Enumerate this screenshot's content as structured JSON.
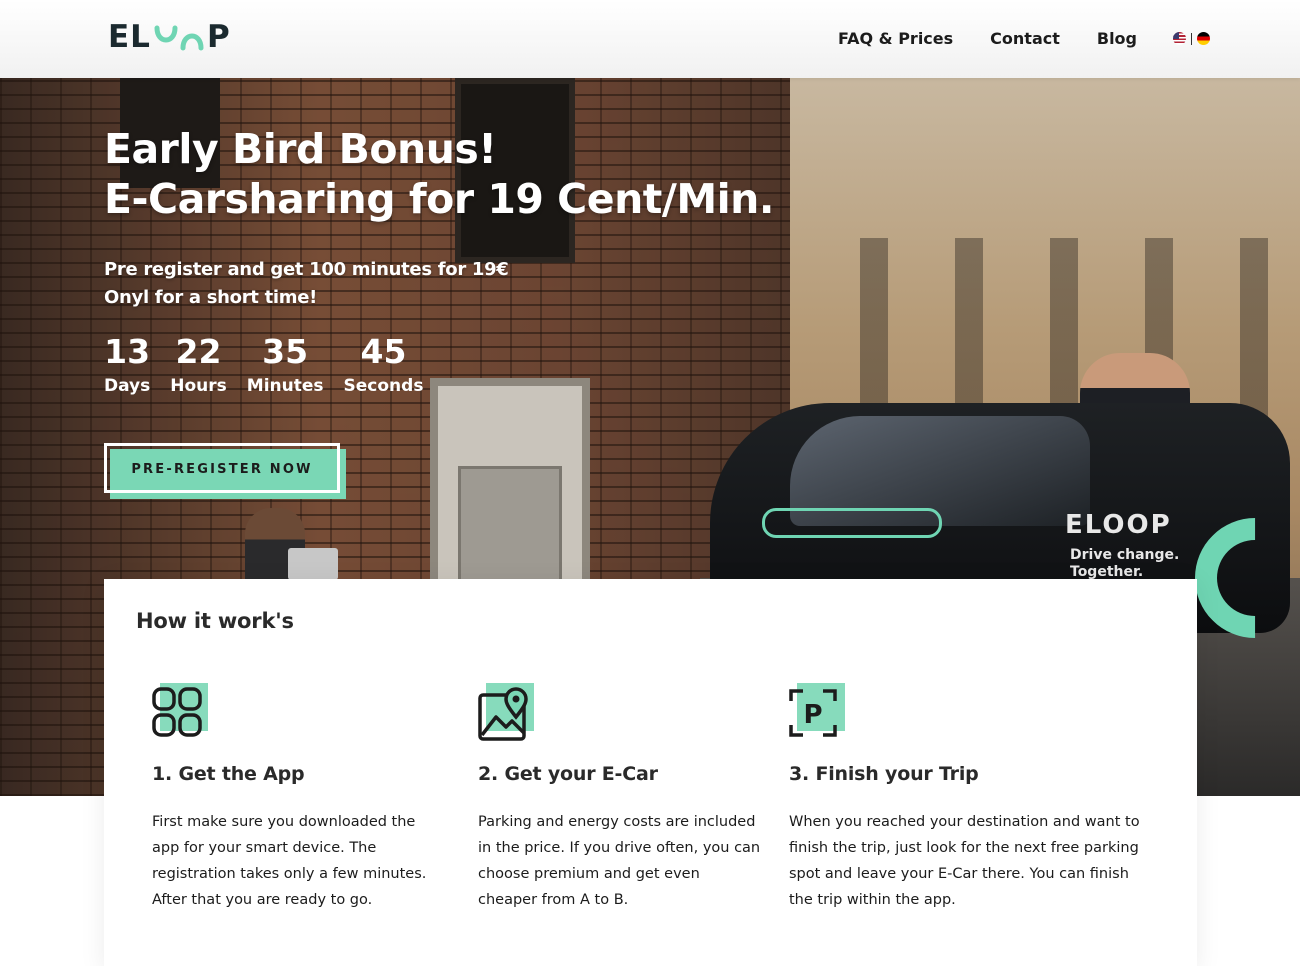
{
  "header": {
    "logo_text": "ELOOP",
    "logo_left": "EL",
    "logo_right": "P",
    "nav": [
      {
        "label": "FAQ & Prices"
      },
      {
        "label": "Contact"
      },
      {
        "label": "Blog"
      }
    ],
    "languages": [
      "en",
      "de"
    ]
  },
  "hero": {
    "title_line1": "Early Bird Bonus!",
    "title_line2": "E-Carsharing for 19 Cent/Min.",
    "sub_line1": "Pre register and get 100 minutes for 19€",
    "sub_line2": "Onyl for a short time!",
    "countdown": [
      {
        "value": "13",
        "label": "Days"
      },
      {
        "value": "22",
        "label": "Hours"
      },
      {
        "value": "35",
        "label": "Minutes"
      },
      {
        "value": "45",
        "label": "Seconds"
      }
    ],
    "cta_label": "PRE-REGISTER NOW",
    "car_brand": "ELOOP",
    "car_tagline_1": "Drive change.",
    "car_tagline_2": "Together."
  },
  "how": {
    "title": "How it work's",
    "steps": [
      {
        "title": "1. Get the App",
        "text": "First make sure you downloaded the app for your smart device. The registration takes only a few minutes. After that you are ready to go.",
        "icon": "app-grid-icon"
      },
      {
        "title": "2. Get your E-Car",
        "text": "Parking and energy costs are included in the price. If you drive often, you can choose premium and get even cheaper from A to B.",
        "icon": "map-pin-icon"
      },
      {
        "title": "3. Finish your Trip",
        "text": "When you reached your destination and want to finish the trip, just look for the next free parking spot and leave your E-Car there. You can finish the trip within the app.",
        "icon": "parking-icon"
      }
    ]
  },
  "colors": {
    "accent": "#7ad7b5",
    "text": "#1c1c1c",
    "logo": "#1b2a2f"
  }
}
